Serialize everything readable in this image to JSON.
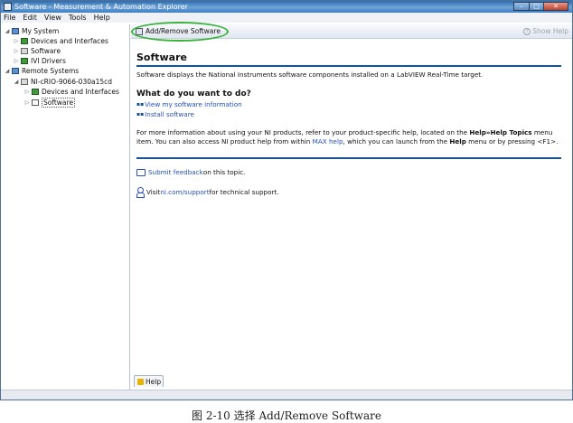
{
  "window": {
    "title": "Software - Measurement & Automation Explorer",
    "controls": {
      "minimize": "–",
      "maximize": "□",
      "close": "✕"
    }
  },
  "menu": [
    "File",
    "Edit",
    "View",
    "Tools",
    "Help"
  ],
  "tree": {
    "my_system": "My System",
    "devices_interfaces": "Devices and Interfaces",
    "software": "Software",
    "ivi_drivers": "IVI Drivers",
    "remote_systems": "Remote Systems",
    "crio": "NI-cRIO-9066-030a15cd",
    "crio_devices": "Devices and Interfaces",
    "crio_software": "Software"
  },
  "toolbar": {
    "add_remove": "Add/Remove Software",
    "show_help": "Show Help"
  },
  "content": {
    "title": "Software",
    "intro": "Software displays the National Instruments software components installed on a LabVIEW Real-Time target.",
    "question": "What do you want to do?",
    "options": [
      "View my software information",
      "Install software"
    ],
    "para": {
      "part1": "For more information about using your NI products, refer to your product-specific help, located on the ",
      "bold1": "Help»Help Topics",
      "part2": " menu item. You can also access NI product help from within ",
      "link": "MAX help",
      "part3": ", which you can launch from the ",
      "bold2": "Help",
      "part4": " menu or by pressing <F1>."
    },
    "feedback_link": "Submit feedback",
    "feedback_rest": " on this topic.",
    "support_prefix": "Visit ",
    "support_link": "ni.com/support",
    "support_rest": " for technical support."
  },
  "bottom_tab": "Help",
  "caption": "图 2-10 选择 Add/Remove Software"
}
